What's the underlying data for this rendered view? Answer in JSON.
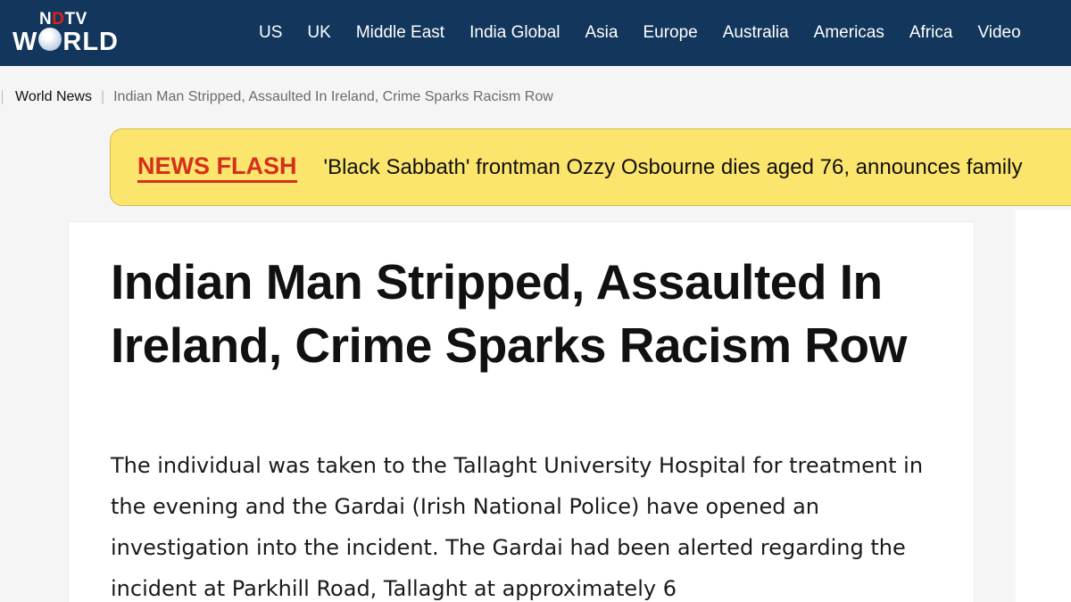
{
  "header": {
    "logo": {
      "top": "NDTV",
      "bottom": "WORLD"
    },
    "nav": [
      "US",
      "UK",
      "Middle East",
      "India Global",
      "Asia",
      "Europe",
      "Australia",
      "Americas",
      "Africa",
      "Video"
    ]
  },
  "breadcrumb": {
    "section": "World News",
    "current": "Indian Man Stripped, Assaulted In Ireland, Crime Sparks Racism Row"
  },
  "newsflash": {
    "label": "NEWS FLASH",
    "text": "'Black Sabbath' frontman Ozzy Osbourne dies aged 76, announces family"
  },
  "article": {
    "headline": "Indian Man Stripped, Assaulted In Ireland, Crime Sparks Racism Row",
    "body": "The individual was taken to the Tallaght University Hospital for treatment in the evening and the Gardai (Irish National Police) have opened an investigation into the incident. The Gardai had been alerted regarding the incident at Parkhill Road, Tallaght at approximately 6"
  },
  "colors": {
    "nav_bg": "#12365c",
    "flash_bg": "#fbe56d",
    "flash_label": "#d4301e",
    "logo_accent": "#e02020"
  }
}
